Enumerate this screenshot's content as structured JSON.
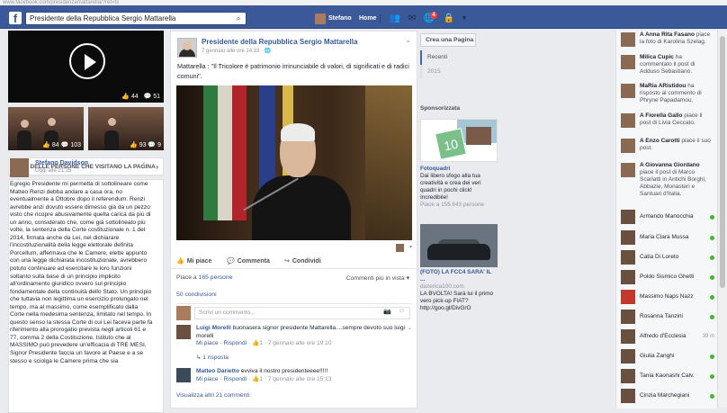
{
  "browser": {
    "url": "www.facebook.com/presidenzamattarella/?ref=ts"
  },
  "topbar": {
    "search_value": "Presidente della Repubblica Sergio Mattarella",
    "user": "Stefano",
    "home": "Home",
    "notif_count": "4"
  },
  "left": {
    "video_likes": "44",
    "video_comments": "51",
    "thumb1_likes": "84",
    "thumb1_comments": "103",
    "thumb2_likes": "93",
    "thumb2_comments": "9",
    "visitors_title": "POST DELLE PERSONE CHE VISITANO LA PAGINA",
    "post_author": "Stefano Davidson",
    "post_time": "Oggi alle 21:25 ·",
    "post_text": "Egregio Presidente mi permetta di sottolineare come Matteo Renzi debba andare a casa ora, no eventualmente a Ottobre dopo il referendum. Renzi avrebbe anzi dovuto essere dimesso già da un pezzo visto che ricopre abusivamente quella carica da più di un anno, considerato che, come già sottolineato più volte, la sentenza della Corte costituzionale n. 1 del 2014, firmata anche da Lei, nel dichiarare l'incostituzionalità della legge elettorale definita Porcellum, affermava che le Camere, elette appunto con una legge dichiarata incostituzionale, avrebbero potuto continuare ad esercitare le loro funzioni soltanto sulla base di un principio implicito all'ordinamento giuridico ovvero sul principio fondamentale della continuità dello Stato. Un principio che tuttavia non legittima un esercizio prolungato nel tempo, ma al massimo, come esemplificato dalla Corte nella medesima sentenza, limitato nel tempo. In questo senso la stessa Corte di cui Lei faceva parte fa riferimento alla prorogatio prevista negli articoli 61 e 77, comma 2 della Costituzione. Istituto che al MASSIMO può prevedere un'efficacia di TRE MESI. Signor Presidente faccia un favore al Paese e a se stesso e sciolga le Camere prima che sia"
  },
  "post": {
    "page_name": "Presidente della Repubblica Sergio Mattarella",
    "time": "7 gennaio alle ore 14:18 · 🌐",
    "text": "Mattarella : \"Il Tricolore è patrimonio irrinunciabile di valori, di significati e di radici comuni\".",
    "like": "Mi piace",
    "comment": "Commenta",
    "share": "Condividi",
    "likes_prefix": "Piace a ",
    "likes_count": "165 persone",
    "order": "Commenti più in vista ▾",
    "shares": "50 condivisioni",
    "comment_placeholder": "Scrivi un commento...",
    "comments": [
      {
        "name": "Luigi Morelli",
        "text": " buonasera signor presidente Mattarella....sempre devoto suo luigi morelli",
        "like": "Mi piace",
        "reply": "Rispondi",
        "count": "1",
        "time": "7 gennaio alle ore 19:10"
      },
      {
        "name": "Matteo Darietto",
        "text": " evviva il nostro presidenteeee!!!!!",
        "like": "Mi piace",
        "reply": "Rispondi",
        "count": "1",
        "time": "7 gennaio alle ore 15:13"
      }
    ],
    "replies": "1 risposta",
    "more": "Visualizza altri 21 commenti"
  },
  "rside": {
    "create": "Crea una Pagina",
    "years": [
      "Recenti",
      "2015"
    ],
    "sponsored": "Sponsorizzata",
    "ad1_title": "Fotoquadri",
    "ad1_text": "Dai libero sfogo alla tua creatività e crea dei veri quadri in pochi click! Incredibile!",
    "ad1_likes": "Piace a 155.643 persone",
    "ad2_title": "(FOTO) LA FCC4 SARA' IL ...",
    "ad2_domain": "dazerica100.com",
    "ad2_text": "LA BVOLTA! Sarà lui il primo vero pick-up FIAT? http://goo.gl/DivGrO"
  },
  "ticker": [
    {
      "n": "A Anna Rita Fasano",
      "t": " piace la foto di Karolina Szelag."
    },
    {
      "n": "Milica Cupic",
      "t": " ha commentato il post di Adduso Sebastiano."
    },
    {
      "n": "MaRia ARistidou",
      "t": " ha risposto al commento di Phryne Papadamou."
    },
    {
      "n": "A Fiorella Gallo",
      "t": " piace il post di Livia Ceccato."
    },
    {
      "n": "A Enzo Carotti",
      "t": " piace il suo post."
    },
    {
      "n": "A Giovanna Giordano",
      "t": " piace il post di Marco Scarlatti in Antichi Borghi, Abbazie, Monasteri e Santuari d'Italia."
    }
  ],
  "chat": [
    {
      "name": "Armando Manocchia",
      "status": ""
    },
    {
      "name": "Maria Clara Mussa",
      "status": ""
    },
    {
      "name": "Catia Di Loreto",
      "status": ""
    },
    {
      "name": "Poldo Sismico Ghetti",
      "status": ""
    },
    {
      "name": "Massimo Naps Nazz...",
      "status": ""
    },
    {
      "name": "Rosanna Tanzini",
      "status": ""
    },
    {
      "name": "Alfredo d'Ecclesia",
      "status": "39 m"
    },
    {
      "name": "Giulia Zanghi",
      "status": ""
    },
    {
      "name": "Tania Kaonashi Calv...",
      "status": ""
    },
    {
      "name": "Cinzia Marchegiani",
      "status": ""
    }
  ]
}
